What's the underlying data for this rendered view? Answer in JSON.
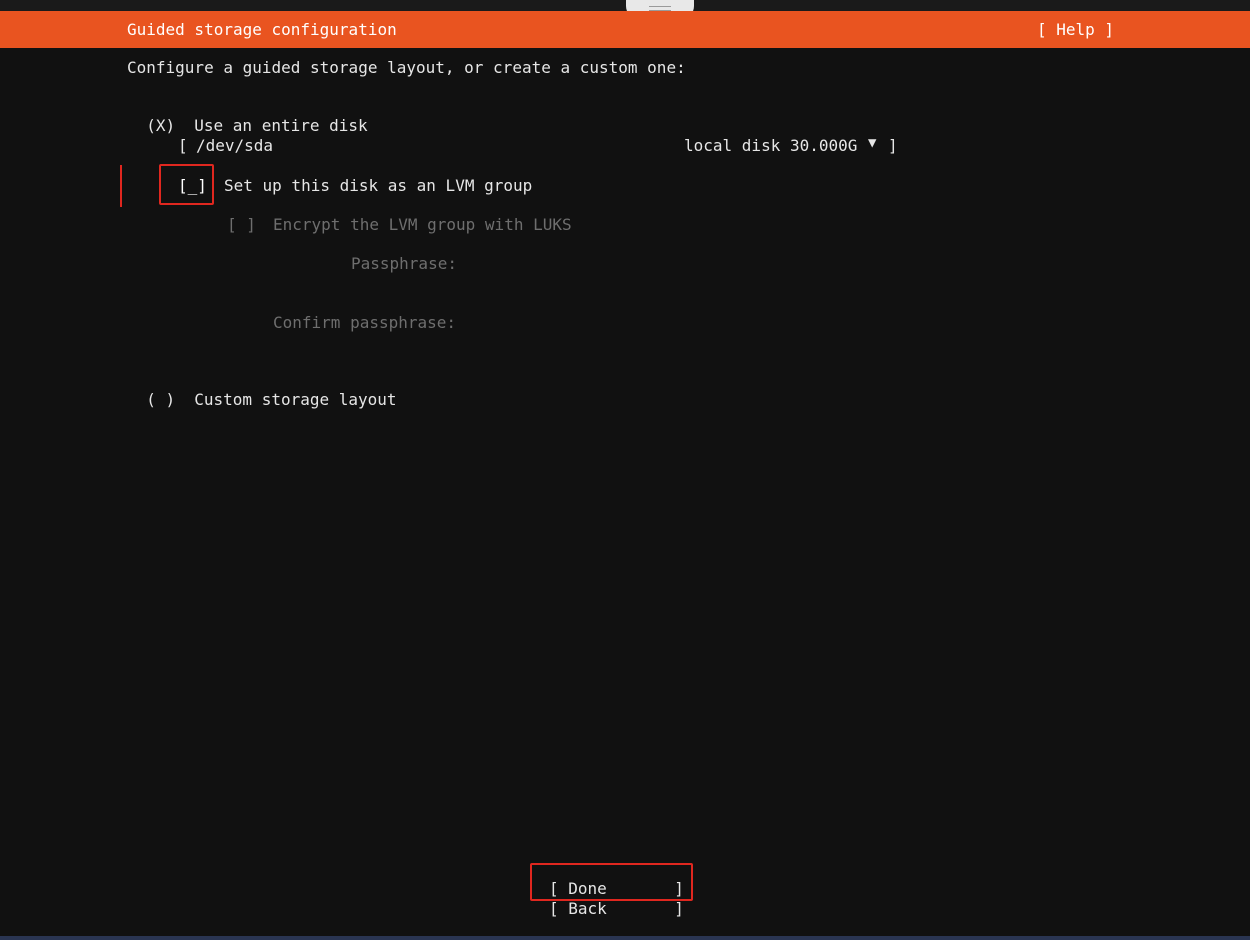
{
  "header": {
    "title": "Guided storage configuration",
    "help_label": "[ Help ]",
    "bg_color": "#e95420"
  },
  "intro": "Configure a guided storage layout, or create a custom one:",
  "options": {
    "entire_disk": {
      "indicator": "(X)",
      "label": "Use an entire disk",
      "selected": true
    },
    "custom": {
      "indicator": "( )",
      "label": "Custom storage layout",
      "selected": false
    }
  },
  "disk_select": {
    "open": "[",
    "device": "/dev/sda",
    "description": "local disk 30.000G",
    "arrow": "▼",
    "close": "]"
  },
  "lvm": {
    "checkbox": "[_]",
    "label": "Set up this disk as an LVM group",
    "checked": false
  },
  "encrypt": {
    "checkbox": "[ ]",
    "label": "Encrypt the LVM group with LUKS",
    "enabled": false
  },
  "passphrase": {
    "label": "Passphrase:",
    "confirm_label": "Confirm passphrase:"
  },
  "buttons": {
    "done": "[ Done       ]",
    "back": "[ Back       ]"
  },
  "colors": {
    "accent": "#e95420",
    "focus_highlight": "#e0271f",
    "background": "#111111",
    "disabled_text": "#6e6e6e"
  }
}
